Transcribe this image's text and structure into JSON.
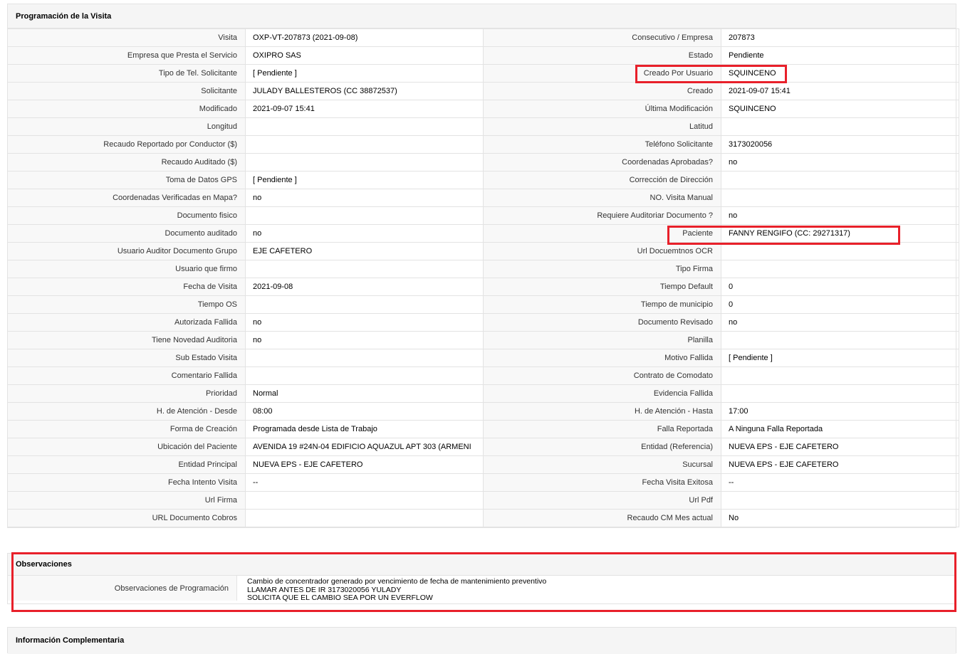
{
  "section_programacion": {
    "title": "Programación de la Visita",
    "rows": [
      [
        "Visita",
        "OXP-VT-207873 (2021-09-08)",
        "Consecutivo / Empresa",
        "207873"
      ],
      [
        "Empresa que Presta el Servicio",
        "OXIPRO SAS",
        "Estado",
        "Pendiente"
      ],
      [
        "Tipo de Tel. Solicitante",
        "[ Pendiente ]",
        "Creado Por Usuario",
        "SQUINCENO"
      ],
      [
        "Solicitante",
        "JULADY BALLESTEROS (CC 38872537)",
        "Creado",
        "2021-09-07 15:41"
      ],
      [
        "Modificado",
        "2021-09-07 15:41",
        "Última Modificación",
        " SQUINCENO"
      ],
      [
        "Longitud",
        "",
        "Latitud",
        ""
      ],
      [
        "Recaudo Reportado por Conductor ($)",
        "",
        "Teléfono Solicitante",
        "3173020056"
      ],
      [
        "Recaudo Auditado ($)",
        "",
        "Coordenadas Aprobadas?",
        " no"
      ],
      [
        "Toma de Datos GPS",
        "[ Pendiente ]",
        "Corrección de Dirección",
        ""
      ],
      [
        "Coordenadas Verificadas en Mapa?",
        " no",
        "NO. Visita Manual",
        ""
      ],
      [
        "Documento fisico",
        "",
        "Requiere Auditoriar Documento ?",
        " no"
      ],
      [
        "Documento auditado",
        " no",
        "Paciente",
        "FANNY RENGIFO (CC: 29271317)"
      ],
      [
        "Usuario Auditor Documento Grupo",
        "EJE CAFETERO",
        "Url Docuemtnos OCR",
        ""
      ],
      [
        "Usuario que firmo",
        "",
        "Tipo Firma",
        ""
      ],
      [
        "Fecha de Visita",
        " 2021-09-08",
        "Tiempo Default",
        "0"
      ],
      [
        "Tiempo OS",
        "",
        "Tiempo de municipio",
        "0"
      ],
      [
        "Autorizada Fallida",
        " no",
        "Documento Revisado",
        " no"
      ],
      [
        "Tiene Novedad Auditoria",
        " no",
        "Planilla",
        ""
      ],
      [
        "Sub Estado Visita",
        "",
        "Motivo Fallida",
        "[ Pendiente ]"
      ],
      [
        "Comentario Fallida",
        "",
        "Contrato de Comodato",
        ""
      ],
      [
        "Prioridad",
        "Normal",
        "Evidencia Fallida",
        ""
      ],
      [
        "H. de Atención - Desde",
        "08:00",
        "H. de Atención - Hasta",
        "17:00"
      ],
      [
        "Forma de Creación",
        "Programada desde Lista de Trabajo",
        "Falla Reportada",
        "A Ninguna Falla Reportada"
      ],
      [
        "Ubicación del Paciente",
        "AVENIDA 19 #24N-04 EDIFICIO AQUAZUL APT 303 (ARMENI",
        "Entidad (Referencia)",
        "NUEVA EPS - EJE CAFETERO"
      ],
      [
        "Entidad Principal",
        "NUEVA EPS - EJE CAFETERO",
        "Sucursal",
        "NUEVA EPS - EJE CAFETERO"
      ],
      [
        "Fecha Intento Visita",
        "--",
        "Fecha Visita Exitosa",
        "--"
      ],
      [
        "Url Firma",
        "",
        "Url Pdf",
        ""
      ],
      [
        "URL Documento Cobros",
        "",
        "Recaudo CM Mes actual",
        "No"
      ]
    ]
  },
  "section_observaciones": {
    "title": "Observaciones",
    "label": "Observaciones de Programación",
    "lines": [
      " Cambio de concentrador generado por vencimiento de fecha de mantenimiento preventivo",
      "LLAMAR ANTES DE IR 3173020056 YULADY",
      "SOLICITA QUE EL CAMBIO SEA POR UN EVERFLOW"
    ]
  },
  "section_complementaria": {
    "title": "Información Complementaria"
  },
  "highlight_color": "#e8202a"
}
